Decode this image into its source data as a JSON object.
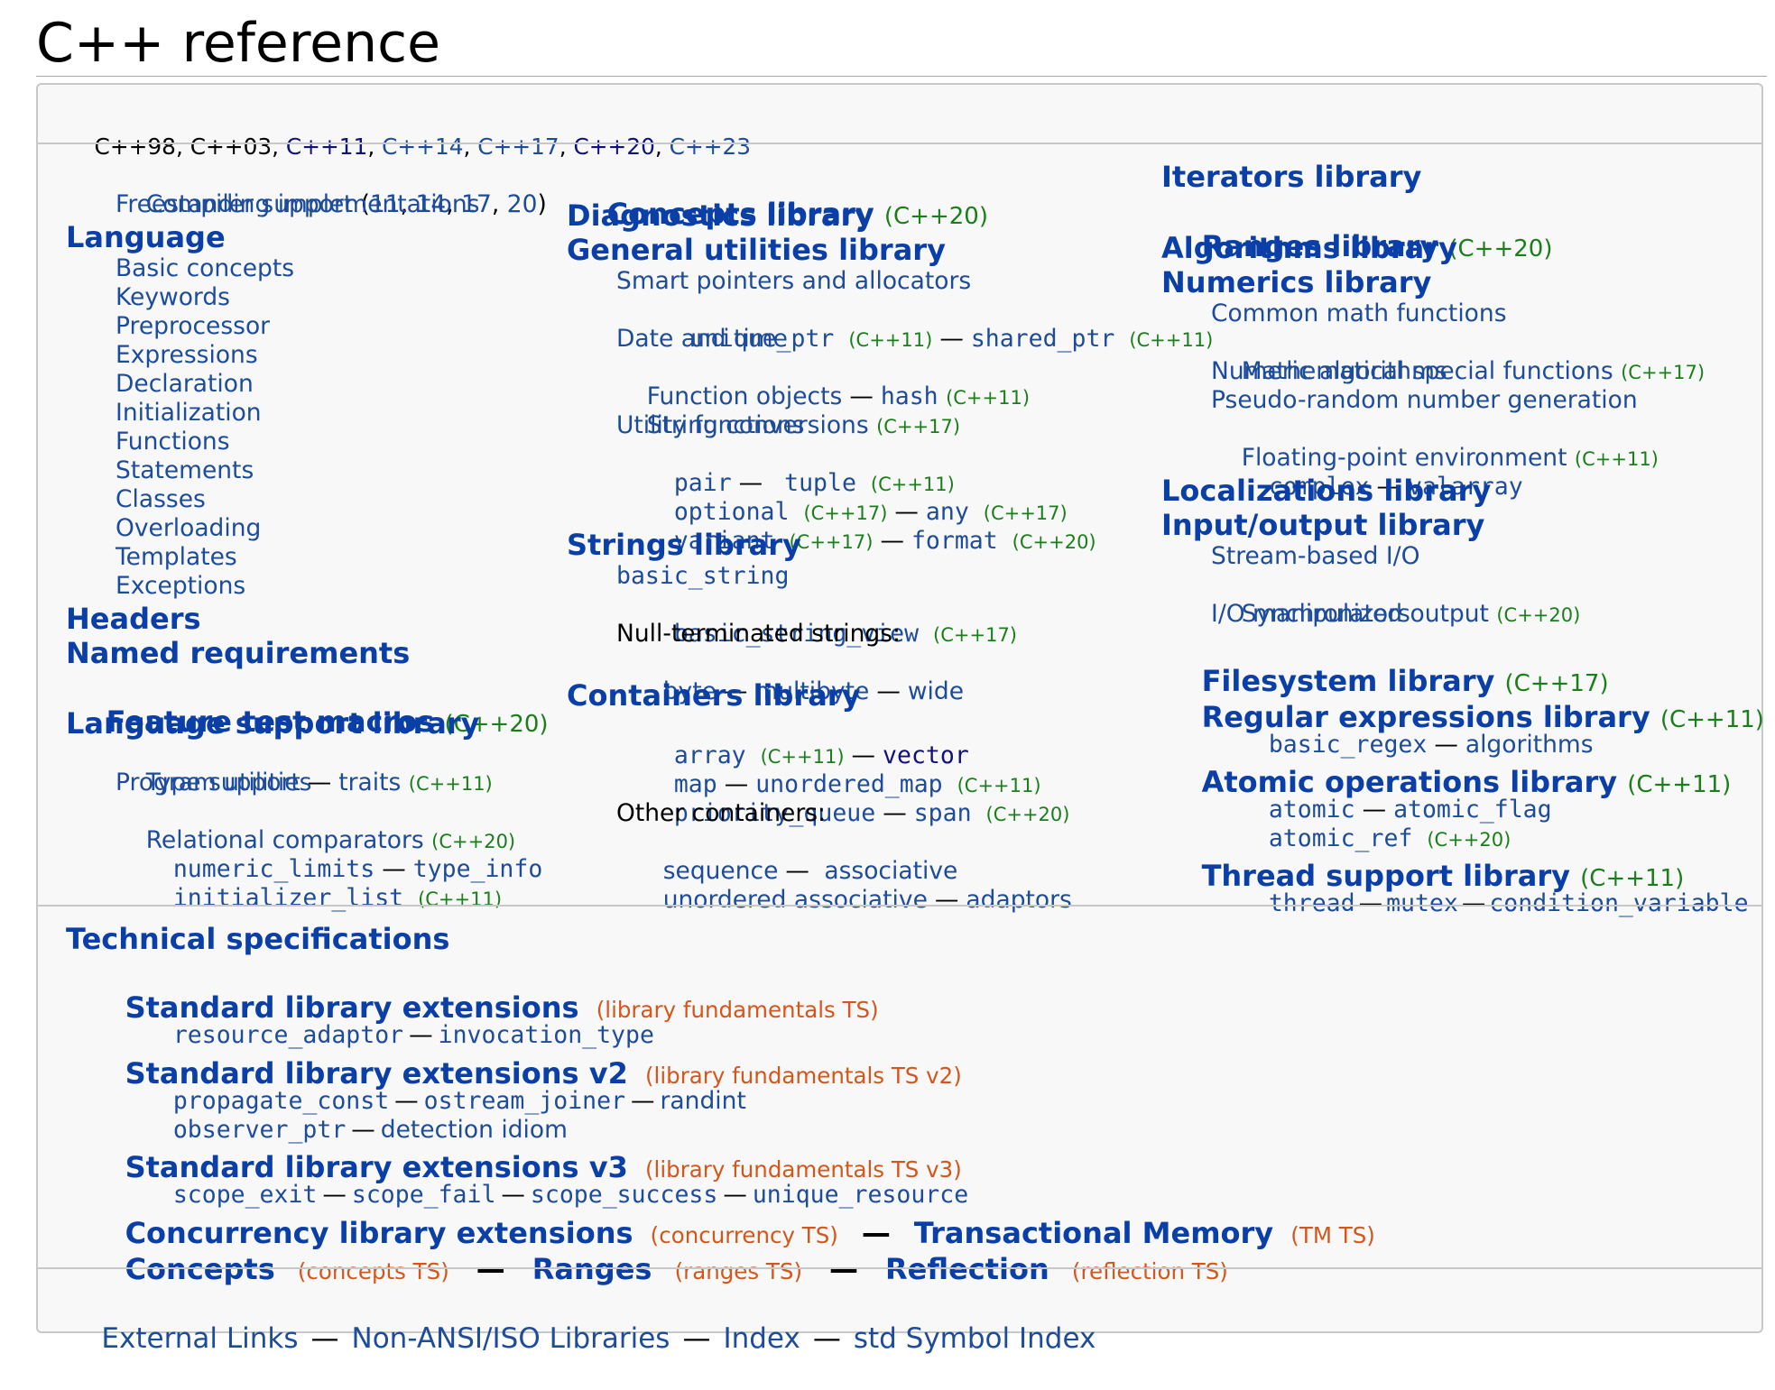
{
  "page": {
    "title": "C++ reference"
  },
  "revisions": [
    "C++98",
    "C++03",
    "C++11",
    "C++14",
    "C++17",
    "C++20",
    "C++23"
  ],
  "col1": {
    "compiler_support": "Compiler support",
    "compiler_versions": [
      "11",
      "14",
      "17",
      "20"
    ],
    "freestanding": "Freestanding implementations",
    "language": "Language",
    "language_items": [
      "Basic concepts",
      "Keywords",
      "Preprocessor",
      "Expressions",
      "Declaration",
      "Initialization",
      "Functions",
      "Statements",
      "Classes",
      "Overloading",
      "Templates",
      "Exceptions"
    ],
    "headers": "Headers",
    "named_requirements": "Named requirements",
    "feature_test_macros": "Feature test macros",
    "feature_test_ver": "(C++20)",
    "lang_support": "Language support library",
    "type_support": "Type support",
    "traits": "traits",
    "traits_ver": "(C++11)",
    "program_utilities": "Program utilities",
    "relational": "Relational comparators",
    "relational_ver": "(C++20)",
    "numeric_limits": "numeric_limits",
    "type_info": "type_info",
    "initializer_list": "initializer_list",
    "initializer_list_ver": "(C++11)"
  },
  "col2": {
    "concepts": "Concepts library",
    "concepts_ver": "(C++20)",
    "diagnostics": "Diagnostics library",
    "general": "General utilities library",
    "smart_pointers": "Smart pointers and allocators",
    "unique_ptr": "unique_ptr",
    "unique_ptr_ver": "(C++11)",
    "shared_ptr": "shared_ptr",
    "shared_ptr_ver": "(C++11)",
    "date_time": "Date and time",
    "function_objects": "Function objects",
    "hash": "hash",
    "hash_ver": "(C++11)",
    "string_conv": "String conversions",
    "string_conv_ver": "(C++17)",
    "utility_functions": "Utility functions",
    "pair": "pair",
    "tuple": "tuple",
    "tuple_ver": "(C++11)",
    "optional": "optional",
    "optional_ver": "(C++17)",
    "any": "any",
    "any_ver": "(C++17)",
    "variant": "variant",
    "variant_ver": "(C++17)",
    "format": "format",
    "format_ver": "(C++20)",
    "strings": "Strings library",
    "basic_string": "basic_string",
    "basic_string_view": "basic_string_view",
    "basic_string_view_ver": "(C++17)",
    "null_terminated": "Null-terminated strings:",
    "byte": "byte",
    "multibyte": "multibyte",
    "wide": "wide",
    "containers": "Containers library",
    "array": "array",
    "array_ver": "(C++11)",
    "vector": "vector",
    "map": "map",
    "unordered_map": "unordered_map",
    "unordered_map_ver": "(C++11)",
    "priority_queue": "priority_queue",
    "span": "span",
    "span_ver": "(C++20)",
    "other_containers": "Other containers:",
    "sequence": "sequence",
    "associative": "associative",
    "unordered_associative": "unordered associative",
    "adaptors": "adaptors"
  },
  "col3": {
    "iterators": "Iterators library",
    "ranges": "Ranges library",
    "ranges_ver": "(C++20)",
    "algorithms": "Algorithms library",
    "numerics": "Numerics library",
    "common_math": "Common math functions",
    "special_math": "Mathematical special functions",
    "special_math_ver": "(C++17)",
    "numeric_algorithms": "Numeric algorithms",
    "prng": "Pseudo-random number generation",
    "fenv": "Floating-point environment",
    "fenv_ver": "(C++11)",
    "complex": "complex",
    "valarray": "valarray",
    "localizations": "Localizations library",
    "io": "Input/output library",
    "stream_io": "Stream-based I/O",
    "sync_output": "Synchronized output",
    "sync_output_ver": "(C++20)",
    "io_manip": "I/O manipulators",
    "filesystem": "Filesystem library",
    "filesystem_ver": "(C++17)",
    "regex": "Regular expressions library",
    "regex_ver": "(C++11)",
    "basic_regex": "basic_regex",
    "regex_algorithms": "algorithms",
    "atomic_ops": "Atomic operations library",
    "atomic_ops_ver": "(C++11)",
    "atomic": "atomic",
    "atomic_flag": "atomic_flag",
    "atomic_ref": "atomic_ref",
    "atomic_ref_ver": "(C++20)",
    "thread_support": "Thread support library",
    "thread_support_ver": "(C++11)",
    "thread": "thread",
    "mutex": "mutex",
    "condition_variable": "condition_variable"
  },
  "ts": {
    "heading": "Technical specifications",
    "ext1": "Standard library extensions",
    "ext1_note": "(library fundamentals TS)",
    "resource_adaptor": "resource_adaptor",
    "invocation_type": "invocation_type",
    "ext2": "Standard library extensions v2",
    "ext2_note": "(library fundamentals TS v2)",
    "propagate_const": "propagate_const",
    "ostream_joiner": "ostream_joiner",
    "randint": "randint",
    "observer_ptr": "observer_ptr",
    "detection_idiom": "detection idiom",
    "ext3": "Standard library extensions v3",
    "ext3_note": "(library fundamentals TS v3)",
    "scope_exit": "scope_exit",
    "scope_fail": "scope_fail",
    "scope_success": "scope_success",
    "unique_resource": "unique_resource",
    "concurrency": "Concurrency library extensions",
    "concurrency_note": "(concurrency TS)",
    "tm": "Transactional Memory",
    "tm_note": "(TM TS)",
    "concepts": "Concepts",
    "concepts_note": "(concepts TS)",
    "ranges": "Ranges",
    "ranges_note": "(ranges TS)",
    "reflection": "Reflection",
    "reflection_note": "(reflection TS)"
  },
  "footer": {
    "links": [
      "External Links",
      "Non-ANSI/ISO Libraries",
      "Index",
      "std Symbol Index"
    ],
    "dash": "—"
  },
  "sep": {
    "dash": "—",
    "comma": ", "
  }
}
